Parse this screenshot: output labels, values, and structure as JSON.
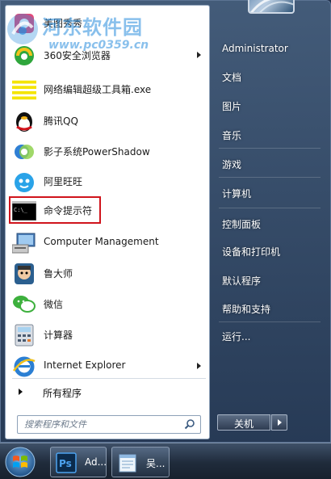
{
  "watermark": {
    "title": "河东软件园",
    "url": "www.pc0359.cn"
  },
  "programs": [
    {
      "label": "美图秀秀",
      "icon": "meitu-xiuxiu-icon",
      "has_submenu": false
    },
    {
      "label": "360安全浏览器",
      "icon": "360-browser-icon",
      "has_submenu": true
    },
    {
      "label": "网络编辑超级工具箱.exe",
      "icon": "toolbox-icon",
      "has_submenu": false
    },
    {
      "label": "腾讯QQ",
      "icon": "qq-penguin-icon",
      "has_submenu": false
    },
    {
      "label": "影子系统PowerShadow",
      "icon": "powershadow-icon",
      "has_submenu": false
    },
    {
      "label": "阿里旺旺",
      "icon": "aliwangwang-icon",
      "has_submenu": false
    },
    {
      "label": "命令提示符",
      "icon": "command-prompt-icon",
      "has_submenu": false
    },
    {
      "label": "Computer Management",
      "icon": "computer-management-icon",
      "has_submenu": false
    },
    {
      "label": "鲁大师",
      "icon": "ludashi-icon",
      "has_submenu": false
    },
    {
      "label": "微信",
      "icon": "wechat-icon",
      "has_submenu": false
    },
    {
      "label": "计算器",
      "icon": "calculator-icon",
      "has_submenu": false
    },
    {
      "label": "Internet Explorer",
      "icon": "internet-explorer-icon",
      "has_submenu": true
    }
  ],
  "all_programs": {
    "label": "所有程序"
  },
  "search": {
    "placeholder": "搜索程序和文件"
  },
  "right_panel": {
    "user": "Administrator",
    "items": [
      {
        "label": "文档"
      },
      {
        "label": "图片"
      },
      {
        "label": "音乐"
      },
      {
        "label": "游戏"
      },
      {
        "label": "计算机"
      },
      {
        "label": "控制面板"
      },
      {
        "label": "设备和打印机"
      },
      {
        "label": "默认程序"
      },
      {
        "label": "帮助和支持"
      },
      {
        "label": "运行..."
      }
    ]
  },
  "shutdown": {
    "label": "关机"
  },
  "taskbar": {
    "items": [
      {
        "label": "Ad...",
        "icon": "photoshop-icon"
      },
      {
        "label": "吴...",
        "icon": "notepad-icon"
      }
    ]
  },
  "colors": {
    "highlight_border": "#d0141c",
    "right_panel_text": "#ffffff",
    "watermark": "#288cdc"
  }
}
